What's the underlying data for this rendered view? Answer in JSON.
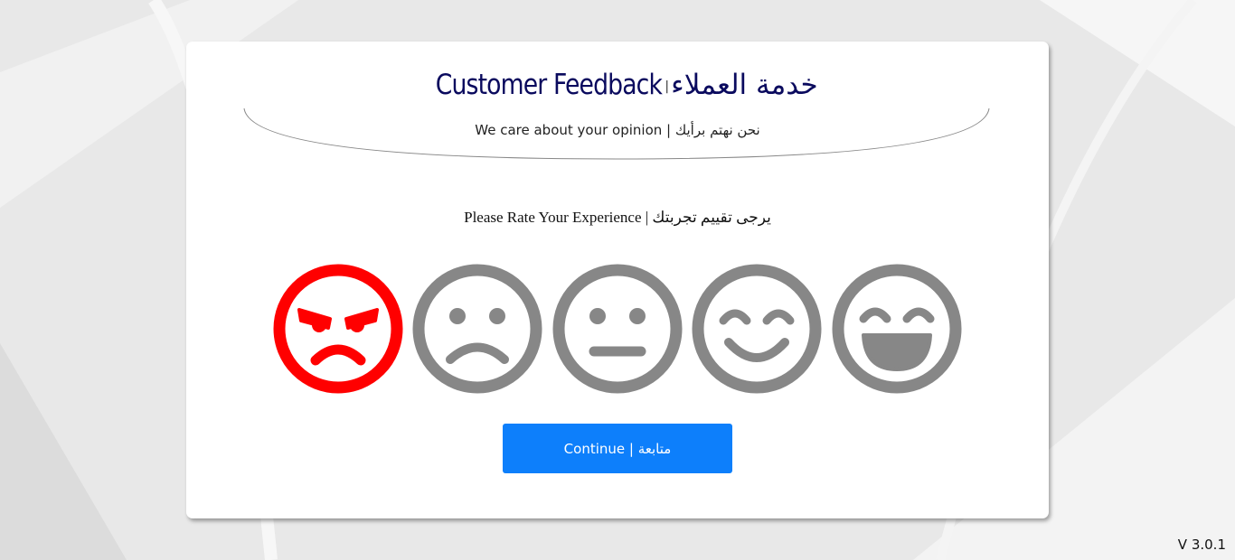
{
  "colors": {
    "title": "#0a0a5e",
    "selected": "#ff0000",
    "unselected": "#878787",
    "button": "#0d7ffb"
  },
  "header": {
    "title_ar": "خدمة العملاء",
    "separator": "|",
    "title_en": "Customer Feedback",
    "subtitle": "We care about your opinion | نحن نهتم برأيك"
  },
  "rating": {
    "prompt": "Please Rate Your Experience | يرجى تقييم تجربتك",
    "faces": [
      {
        "icon": "angry-face-icon",
        "selected": true
      },
      {
        "icon": "sad-face-icon",
        "selected": false
      },
      {
        "icon": "neutral-face-icon",
        "selected": false
      },
      {
        "icon": "smiling-face-icon",
        "selected": false
      },
      {
        "icon": "happy-face-icon",
        "selected": false
      }
    ]
  },
  "continue_button": {
    "label": "Continue | متابعة"
  },
  "version": "V 3.0.1"
}
